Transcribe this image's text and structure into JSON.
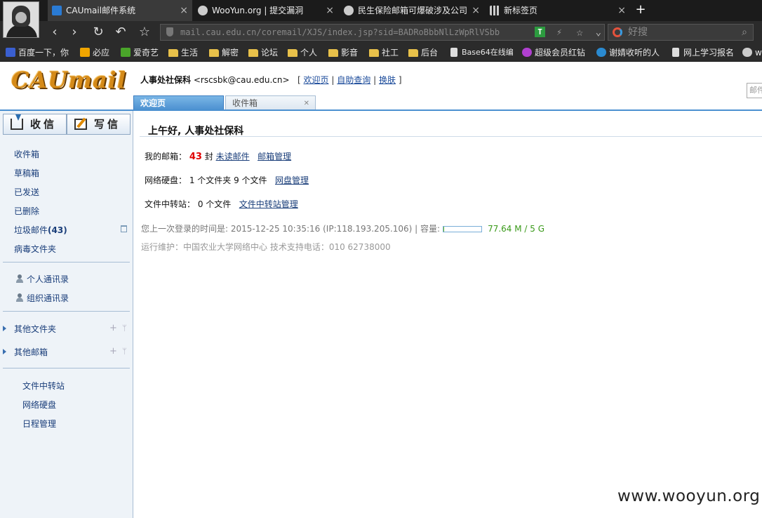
{
  "browser": {
    "tabs": [
      {
        "title": "CAUmail邮件系统",
        "icon_color": "#2a7bd4"
      },
      {
        "title": "WooYun.org | 提交漏洞",
        "icon_color": "#cccccc"
      },
      {
        "title": "民生保险邮箱可爆破涉及公司",
        "icon_color": "#cccccc"
      },
      {
        "title": "新标签页",
        "icon_color": "#cccccc"
      }
    ],
    "new_tab": "+",
    "url": "mail.cau.edu.cn/coremail/XJS/index.jsp?sid=BADRoBbbNlLzWpRlVSbb",
    "search_placeholder": "好搜",
    "bookmarks": [
      "百度一下，你",
      "必应",
      "爱奇艺",
      "生活",
      "解密",
      "论坛",
      "个人",
      "影音",
      "社工",
      "后台",
      "Base64在线编",
      "超级会员红钻",
      "谢婧收听的人",
      "网上学习报名",
      "w"
    ]
  },
  "header": {
    "logo": "CAUmail",
    "user_name": "人事处社保科",
    "user_email": "<rscsbk@cau.edu.cn>",
    "links": [
      "欢迎页",
      "自助查询",
      "换肤"
    ],
    "search_placeholder": "邮件"
  },
  "app_tabs": [
    "欢迎页",
    "收件箱"
  ],
  "sidebar": {
    "receive": "收信",
    "write": "写信",
    "folders": [
      {
        "label": "收件箱"
      },
      {
        "label": "草稿箱"
      },
      {
        "label": "已发送"
      },
      {
        "label": "已删除"
      },
      {
        "label": "垃圾邮件",
        "count": "(43)"
      },
      {
        "label": "病毒文件夹"
      }
    ],
    "contacts": [
      "个人通讯录",
      "组织通讯录"
    ],
    "groups": [
      "其他文件夹",
      "其他邮箱"
    ],
    "tools": [
      "文件中转站",
      "网络硬盘",
      "日程管理"
    ]
  },
  "main": {
    "greeting": "上午好, 人事处社保科",
    "mailbox_label": "我的邮箱：",
    "mailbox_count": "43",
    "mailbox_unit": "封",
    "unread_link": "未读邮件",
    "mailbox_manage": "邮箱管理",
    "disk_label": "网络硬盘：",
    "disk_info": "1 个文件夹 9 个文件",
    "disk_manage": "网盘管理",
    "transfer_label": "文件中转站：",
    "transfer_info": "0 个文件",
    "transfer_manage": "文件中转站管理",
    "last_login": "您上一次登录的时间是: 2015-12-25 10:35:16 (IP:118.193.205.106)  |  容量:",
    "capacity": "77.64 M / 5 G",
    "capacity_fraction": 0.015,
    "maintenance": "运行维护：中国农业大学网络中心 技术支持电话：010 62738000"
  },
  "watermark": "www.wooyun.org"
}
